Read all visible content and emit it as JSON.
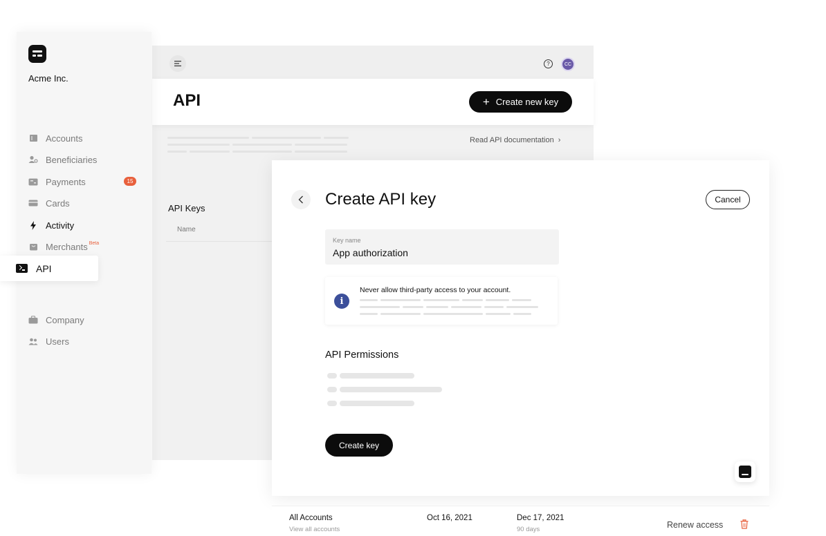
{
  "sidebar": {
    "company": "Acme Inc.",
    "items": [
      {
        "label": "Accounts",
        "icon": "accounts-icon"
      },
      {
        "label": "Beneficiaries",
        "icon": "beneficiaries-icon"
      },
      {
        "label": "Payments",
        "icon": "payments-icon",
        "badge": "15"
      },
      {
        "label": "Cards",
        "icon": "cards-icon"
      },
      {
        "label": "Activity",
        "icon": "activity-icon"
      },
      {
        "label": "Merchants",
        "icon": "merchants-icon",
        "tag": "Beta"
      },
      {
        "label": "API",
        "icon": "terminal-icon",
        "active": true
      },
      {
        "label": "Company",
        "icon": "company-icon"
      },
      {
        "label": "Users",
        "icon": "users-icon"
      }
    ]
  },
  "topbar": {
    "help_glyph": "?",
    "avatar_initials": "CC"
  },
  "header": {
    "title": "API",
    "create_new_label": "Create new key",
    "docs_link": "Read API documentation"
  },
  "keys_section": {
    "title": "API Keys",
    "name_column": "Name"
  },
  "modal": {
    "title": "Create API key",
    "cancel_label": "Cancel",
    "key_name_label": "Key name",
    "key_name_value": "App authorization",
    "warning": "Never allow third-party access to your account.",
    "permissions_title": "API Permissions",
    "submit_label": "Create key"
  },
  "row": {
    "scope": "All Accounts",
    "scope_sub": "View all accounts",
    "created": "Oct 16, 2021",
    "expires": "Dec 17, 2021",
    "expires_sub": "90 days",
    "renew_label": "Renew access"
  },
  "colors": {
    "accent_badge": "#e8603c",
    "info_icon": "#3c4f9a",
    "avatar": "#6a5aa8",
    "primary_button": "#0c0c0c"
  }
}
